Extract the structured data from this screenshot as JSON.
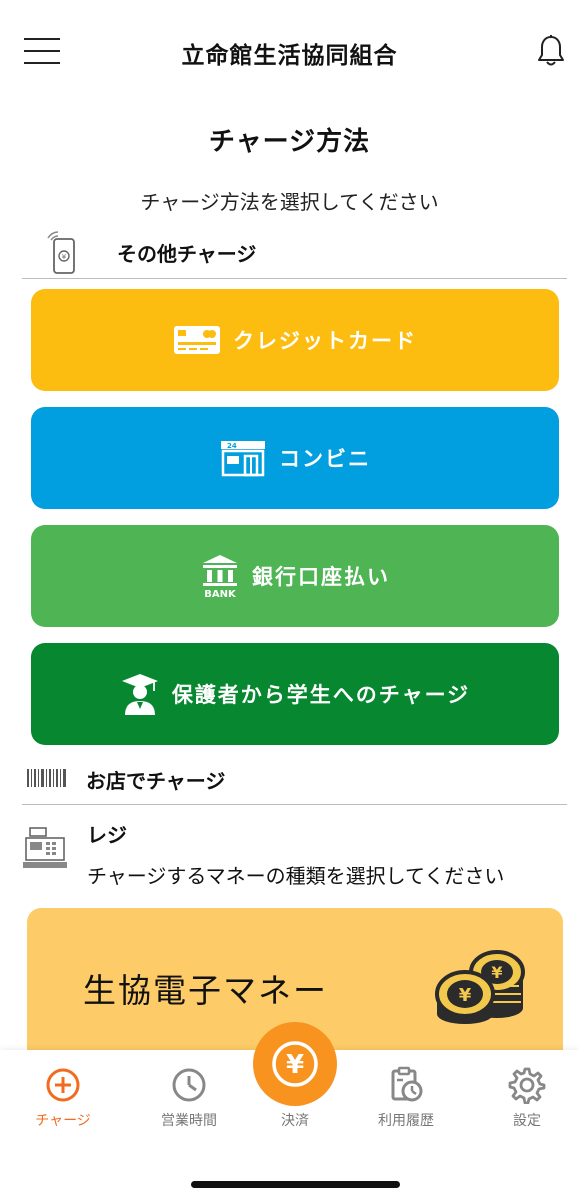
{
  "header": {
    "title": "立命館生活協同組合"
  },
  "page": {
    "title": "チャージ方法",
    "subtitle": "チャージ方法を選択してください"
  },
  "sections": {
    "other": {
      "label": "その他チャージ"
    },
    "store": {
      "label": "お店でチャージ"
    }
  },
  "methods": {
    "credit_card": {
      "label": "クレジットカード",
      "color": "#fcbd10"
    },
    "convenience": {
      "label": "コンビニ",
      "color": "#029fe0"
    },
    "bank": {
      "label": "銀行口座払い",
      "color": "#4fb454"
    },
    "guardian": {
      "label": "保護者から学生へのチャージ",
      "color": "#068730"
    }
  },
  "icons": {
    "convenience_store_sign": "24",
    "bank_caption": "BANK",
    "coin_symbol": "¥",
    "pay_symbol": "¥"
  },
  "register": {
    "title": "レジ",
    "description": "チャージするマネーの種類を選択してください"
  },
  "money": {
    "label": "生協電子マネー",
    "color": "#fdcb67"
  },
  "tabs": {
    "charge": "チャージ",
    "hours": "営業時間",
    "pay": "決済",
    "history": "利用履歴",
    "settings": "設定"
  },
  "colors": {
    "accent": "#f26c1f",
    "pay_button": "#f7931e",
    "inactive": "#777777"
  }
}
